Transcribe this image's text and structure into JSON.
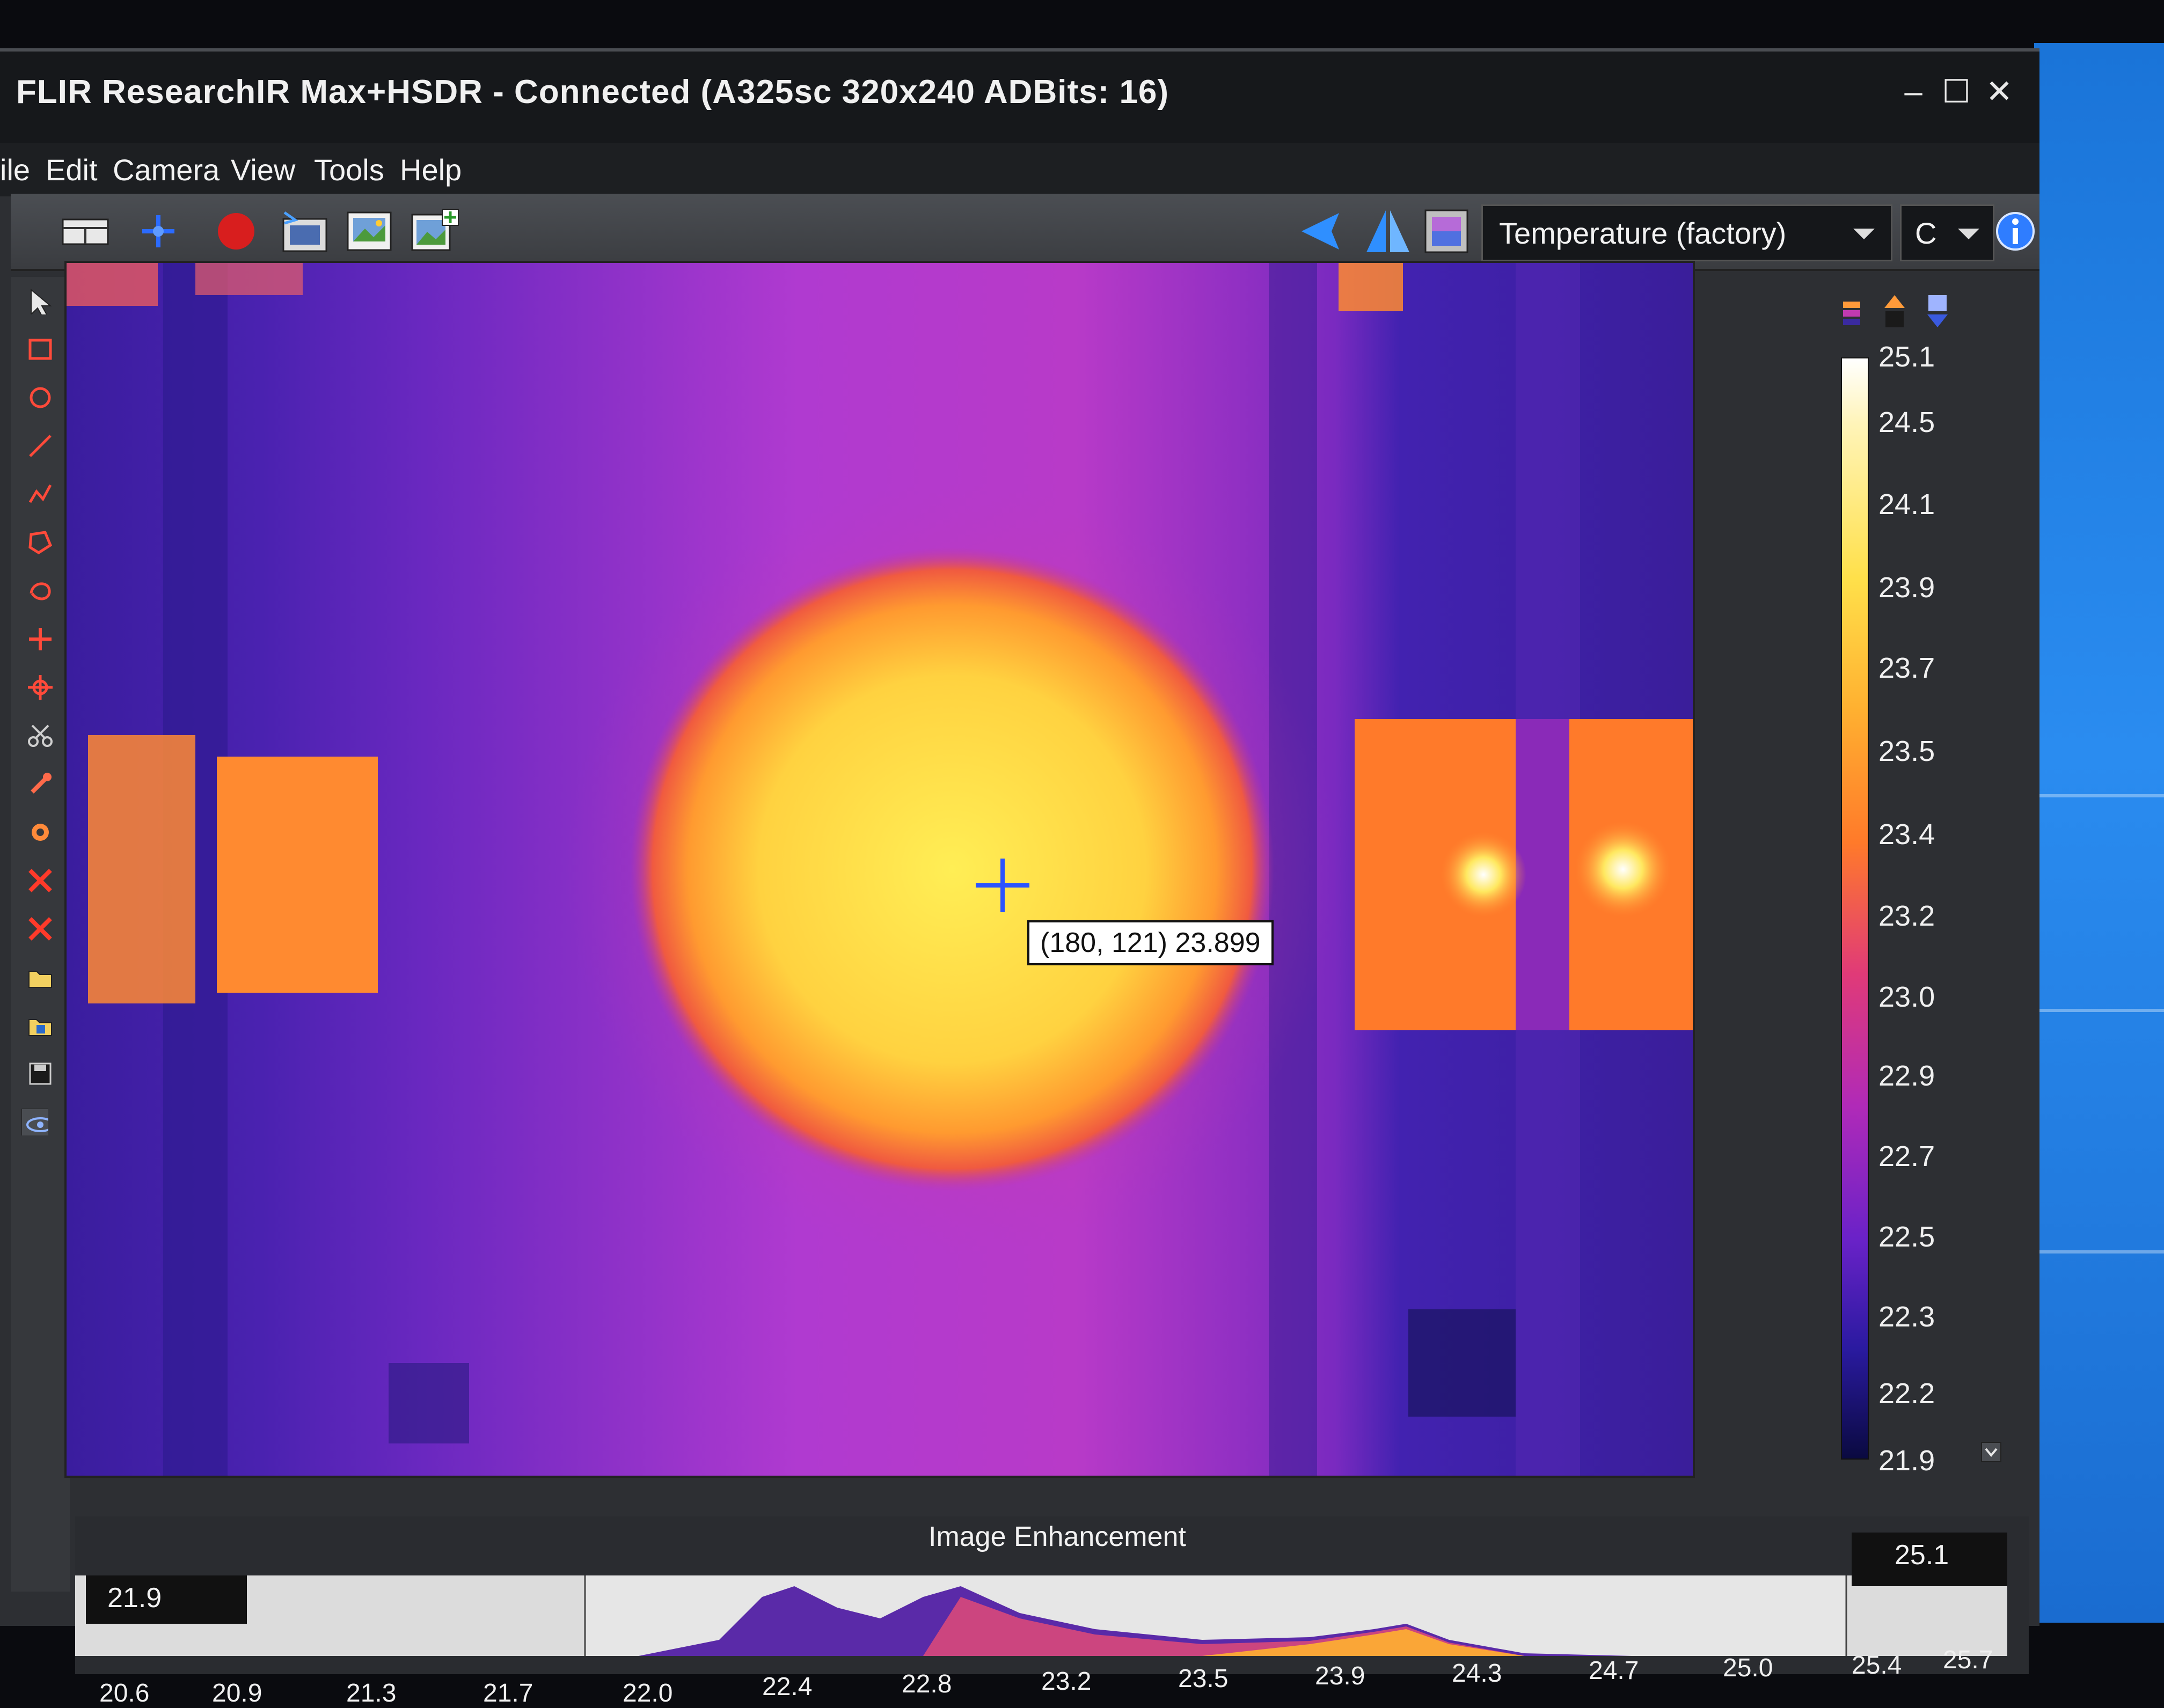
{
  "window": {
    "title": "FLIR ResearchIR Max+HSDR - Connected (A325sc 320x240 ADBits: 16)",
    "controls": {
      "minimize": "–",
      "maximize": "☐",
      "close": "✕"
    }
  },
  "menu": [
    "ile",
    "Edit",
    "Camera",
    "View",
    "Tools",
    "Help"
  ],
  "toolbar": {
    "palette_label": "Temperature (factory)",
    "unit_label": "C"
  },
  "readout": {
    "text": "(180, 121) 23.899"
  },
  "colorbar": {
    "labels": [
      "25.1",
      "24.5",
      "24.1",
      "23.9",
      "23.7",
      "23.5",
      "23.4",
      "23.2",
      "23.0",
      "22.9",
      "22.7",
      "22.5",
      "22.3",
      "22.2",
      "21.9"
    ]
  },
  "enhancement": {
    "title": "Image Enhancement",
    "min": "21.9",
    "max": "25.1",
    "ticks": [
      "20.6",
      "20.9",
      "21.3",
      "21.7",
      "22.0",
      "22.4",
      "22.8",
      "23.2",
      "23.5",
      "23.9",
      "24.3",
      "24.7",
      "25.0",
      "25.4",
      "25.7"
    ]
  },
  "colors": {
    "accent_blue": "#2b54ff",
    "record_red": "#d81e1e",
    "desktop_blue": "#1a74d8"
  }
}
